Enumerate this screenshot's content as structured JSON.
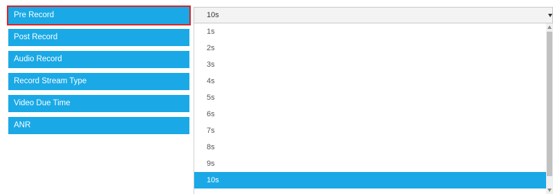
{
  "labels": [
    {
      "text": "Pre Record",
      "highlighted": true
    },
    {
      "text": "Post Record",
      "highlighted": false
    },
    {
      "text": "Audio Record",
      "highlighted": false
    },
    {
      "text": "Record Stream Type",
      "highlighted": false
    },
    {
      "text": "Video Due Time",
      "highlighted": false
    },
    {
      "text": "ANR",
      "highlighted": false
    }
  ],
  "select": {
    "value": "10s",
    "icon": "chevron-down-icon"
  },
  "dropdown": {
    "options": [
      "1s",
      "2s",
      "3s",
      "4s",
      "5s",
      "6s",
      "7s",
      "8s",
      "9s",
      "10s"
    ],
    "selected_index": 9
  },
  "colors": {
    "accent": "#1aa9e6",
    "highlight_border": "#e02020"
  }
}
